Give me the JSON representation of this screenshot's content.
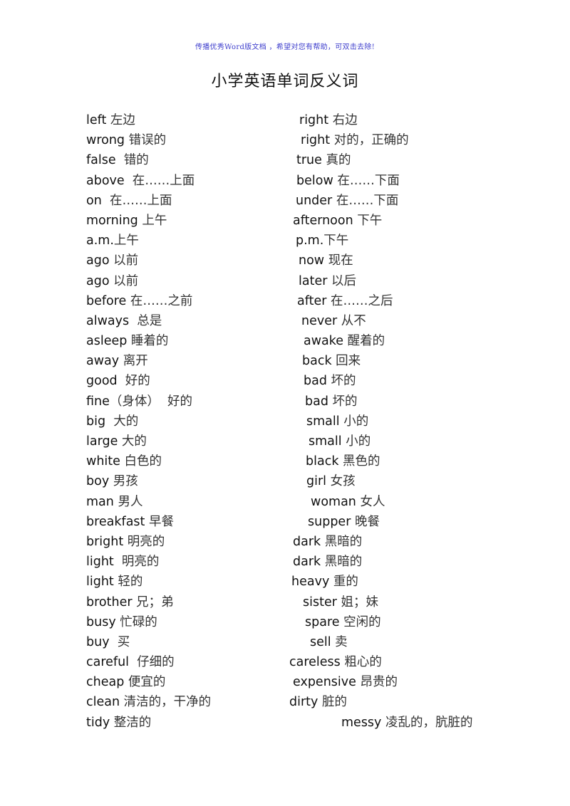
{
  "banner": "传播优秀Word版文档 ，希望对您有帮助，可双击去除!",
  "title": "小学英语单词反义词",
  "pairs": [
    {
      "left_en": "left",
      "left_zh": " 左边",
      "right_en": "right",
      "right_zh": " 右边"
    },
    {
      "left_en": "wrong",
      "left_zh": " 错误的",
      "right_en": "right",
      "right_zh": " 对的，正确的"
    },
    {
      "left_en": "false",
      "left_zh": "  错的",
      "right_en": "true",
      "right_zh": " 真的"
    },
    {
      "left_en": "above",
      "left_zh": "  在……上面",
      "right_en": "below",
      "right_zh": " 在……下面"
    },
    {
      "left_en": "on",
      "left_zh": "  在……上面",
      "right_en": "under",
      "right_zh": " 在……下面"
    },
    {
      "left_en": "morning",
      "left_zh": " 上午",
      "right_en": "afternoon",
      "right_zh": " 下午"
    },
    {
      "left_en": "a.m.",
      "left_zh": "上午",
      "right_en": "p.m.",
      "right_zh": "下午"
    },
    {
      "left_en": "ago",
      "left_zh": " 以前",
      "right_en": "now",
      "right_zh": " 现在"
    },
    {
      "left_en": "ago",
      "left_zh": " 以前",
      "right_en": "later",
      "right_zh": " 以后"
    },
    {
      "left_en": "before",
      "left_zh": " 在……之前",
      "right_en": "after",
      "right_zh": " 在……之后"
    },
    {
      "left_en": "always",
      "left_zh": "  总是",
      "right_en": "never",
      "right_zh": " 从不"
    },
    {
      "left_en": "asleep",
      "left_zh": " 睡着的",
      "right_en": "awake",
      "right_zh": " 醒着的"
    },
    {
      "left_en": "away",
      "left_zh": " 离开",
      "right_en": "back",
      "right_zh": " 回来"
    },
    {
      "left_en": "good",
      "left_zh": "  好的",
      "right_en": "bad",
      "right_zh": " 坏的"
    },
    {
      "left_en": "fine",
      "left_zh": "（身体）  好的",
      "right_en": "bad",
      "right_zh": " 坏的"
    },
    {
      "left_en": "big",
      "left_zh": "  大的",
      "right_en": "small",
      "right_zh": " 小的"
    },
    {
      "left_en": "large",
      "left_zh": " 大的",
      "right_en": "small",
      "right_zh": " 小的"
    },
    {
      "left_en": "white",
      "left_zh": " 白色的",
      "right_en": "black",
      "right_zh": " 黑色的"
    },
    {
      "left_en": "boy",
      "left_zh": " 男孩",
      "right_en": "girl",
      "right_zh": " 女孩"
    },
    {
      "left_en": "man",
      "left_zh": " 男人",
      "right_en": "woman",
      "right_zh": " 女人"
    },
    {
      "left_en": "breakfast",
      "left_zh": " 早餐",
      "right_en": "supper",
      "right_zh": " 晚餐"
    },
    {
      "left_en": "bright",
      "left_zh": " 明亮的",
      "right_en": "dark",
      "right_zh": " 黑暗的"
    },
    {
      "left_en": "light",
      "left_zh": "  明亮的",
      "right_en": "dark",
      "right_zh": " 黑暗的"
    },
    {
      "left_en": "light",
      "left_zh": " 轻的",
      "right_en": "heavy",
      "right_zh": " 重的"
    },
    {
      "left_en": "brother",
      "left_zh": " 兄；弟",
      "right_en": "sister",
      "right_zh": " 姐；妹"
    },
    {
      "left_en": "busy",
      "left_zh": " 忙碌的",
      "right_en": "spare",
      "right_zh": " 空闲的"
    },
    {
      "left_en": "buy",
      "left_zh": "  买",
      "right_en": "sell",
      "right_zh": " 卖"
    },
    {
      "left_en": "careful",
      "left_zh": "  仔细的",
      "right_en": "careless",
      "right_zh": " 粗心的"
    },
    {
      "left_en": "cheap",
      "left_zh": " 便宜的",
      "right_en": "expensive",
      "right_zh": " 昂贵的"
    },
    {
      "left_en": "clean",
      "left_zh": " 清洁的，干净的",
      "right_en": "dirty",
      "right_zh": " 脏的"
    },
    {
      "left_en": "tidy",
      "left_zh": " 整洁的",
      "right_en": "messy",
      "right_zh": " 凌乱的，肮脏的"
    }
  ]
}
